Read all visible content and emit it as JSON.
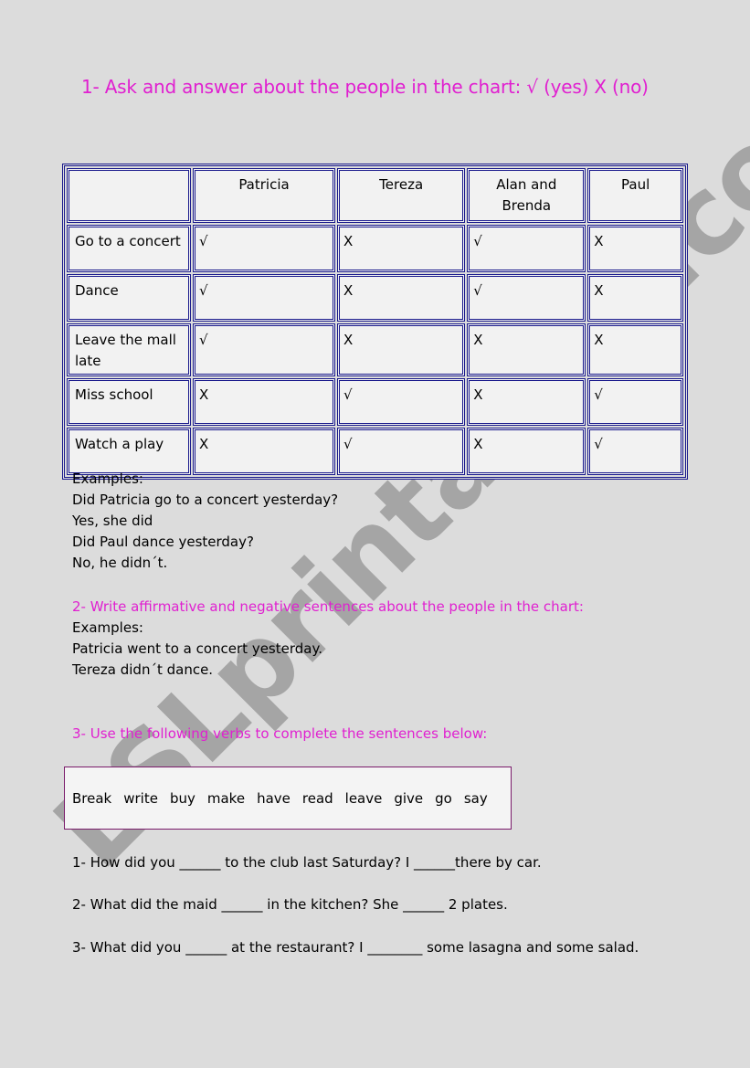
{
  "heading1": "1- Ask and answer about the people in the chart: √ (yes) X (no)",
  "table": {
    "columns": [
      "",
      "Patricia",
      "Tereza",
      "Alan and Brenda",
      "Paul"
    ],
    "rows": [
      {
        "activity": "Go to a concert",
        "marks": [
          "√",
          "X",
          "√",
          "X"
        ]
      },
      {
        "activity": "Dance",
        "marks": [
          "√",
          "X",
          "√",
          "X"
        ]
      },
      {
        "activity": "Leave the mall late",
        "marks": [
          "√",
          "X",
          "X",
          "X"
        ]
      },
      {
        "activity": "Miss school",
        "marks": [
          "X",
          "√",
          "X",
          "√"
        ]
      },
      {
        "activity": "Watch a play",
        "marks": [
          "X",
          "√",
          "X",
          "√"
        ]
      }
    ]
  },
  "examples1": [
    "Examples:",
    "Did Patricia go to a concert yesterday?",
    "Yes, she did",
    "Did Paul dance yesterday?",
    "No, he didn´t."
  ],
  "heading2": "2- Write affirmative and negative sentences about the people in the chart:",
  "examples2": [
    "Examples:",
    "Patricia went to a concert yesterday.",
    "Tereza didn´t dance."
  ],
  "heading3": "3- Use the following verbs to complete the sentences below:",
  "verbs": [
    "Break",
    "write",
    "buy",
    "make",
    "have",
    "read",
    "leave",
    "give",
    "go",
    "say"
  ],
  "sentences": [
    "1- How did you  ______ to the club last Saturday? I ______there by car.",
    "2- What did the maid ______ in the kitchen? She ______ 2 plates.",
    "3- What did you ______ at the restaurant? I ________ some lasagna and some salad."
  ],
  "watermark": "ESLprintables.com"
}
